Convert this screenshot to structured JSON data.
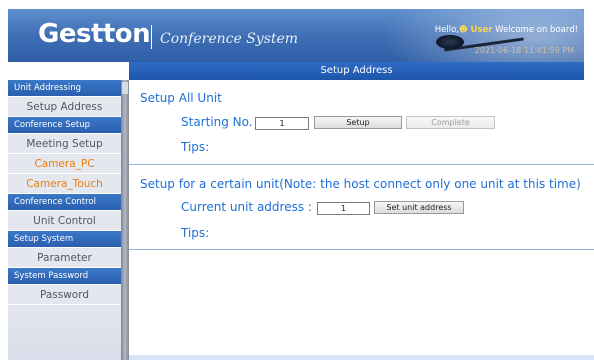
{
  "header": {
    "brand": "Gestton",
    "subtitle": "Conference System",
    "faint_text": "",
    "greeting": "Hello,",
    "user": "User",
    "welcome": "Welcome on board!",
    "datetime": "2021-06-18 11:41:59 PM"
  },
  "page": {
    "title": "Setup Address"
  },
  "sidebar": {
    "groups": [
      {
        "label": "Unit Addressing",
        "items": [
          {
            "label": "Setup Address"
          }
        ]
      },
      {
        "label": "Conference Setup",
        "items": [
          {
            "label": "Meeting Setup"
          },
          {
            "label": "Camera_PC"
          },
          {
            "label": "Camera_Touch"
          }
        ]
      },
      {
        "label": "Conference Control",
        "items": [
          {
            "label": "Unit Control"
          }
        ]
      },
      {
        "label": "Setup System",
        "items": [
          {
            "label": "Parameter"
          }
        ]
      },
      {
        "label": "System Password",
        "items": [
          {
            "label": "Password"
          }
        ]
      }
    ]
  },
  "setup_all": {
    "title": "Setup All Unit",
    "starting_label": "Starting No.",
    "starting_value": "1",
    "setup_button": "Setup",
    "complete_button": "Complete",
    "tips_label": "Tips:"
  },
  "setup_one": {
    "title": "Setup for a certain unit(Note: the host connect only one unit at this time)",
    "current_label": "Current unit address :",
    "current_value": "1",
    "set_button": "Set unit address",
    "tips_label": "Tips:"
  },
  "colors": {
    "accent_blue": "#1f6fd6",
    "header_blue": "#3f6fb5",
    "nav_orange": "#e87f10",
    "nav_group_blue": "#2a5fae"
  }
}
